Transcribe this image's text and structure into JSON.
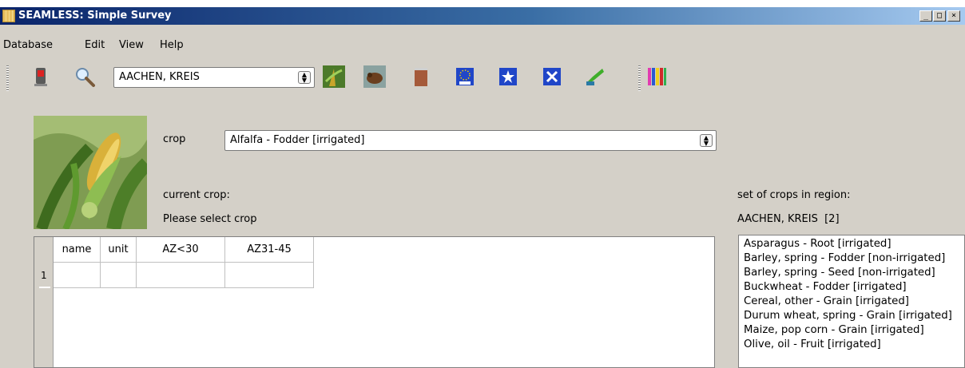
{
  "window": {
    "title": "SEAMLESS: Simple Survey",
    "buttons": [
      "_",
      "□",
      "×"
    ]
  },
  "menubar": {
    "items": [
      "Database",
      "Edit",
      "View",
      "Help"
    ]
  },
  "toolbar": {
    "region_select": {
      "value": "AACHEN, KREIS"
    },
    "icons": [
      "phone-icon",
      "search-icon",
      "crop-icon",
      "livestock-icon",
      "building-icon",
      "eu-flag-icon",
      "eu-star-icon",
      "eu-cross-icon",
      "green-tool-icon",
      "color-bars-icon"
    ]
  },
  "crop_panel": {
    "crop_label": "crop",
    "crop_value": "Alfalfa - Fodder [irrigated]",
    "current_crop_label": "current crop:",
    "current_crop_value": "Please select crop"
  },
  "table": {
    "columns": [
      "name",
      "unit",
      "AZ<30",
      "AZ31-45"
    ],
    "rows": [
      [
        "1"
      ]
    ]
  },
  "region_panel": {
    "label": "set of crops in region:",
    "region_name": "AACHEN, KREIS  [2]",
    "crops": [
      "Asparagus - Root [irrigated]",
      "Barley, spring - Fodder [non-irrigated]",
      "Barley, spring - Seed [non-irrigated]",
      "Buckwheat - Fodder [irrigated]",
      "Cereal, other - Grain [irrigated]",
      "Durum wheat, spring - Grain [irrigated]",
      "Maize, pop corn - Grain [irrigated]",
      "Olive, oil - Fruit [irrigated]"
    ]
  }
}
